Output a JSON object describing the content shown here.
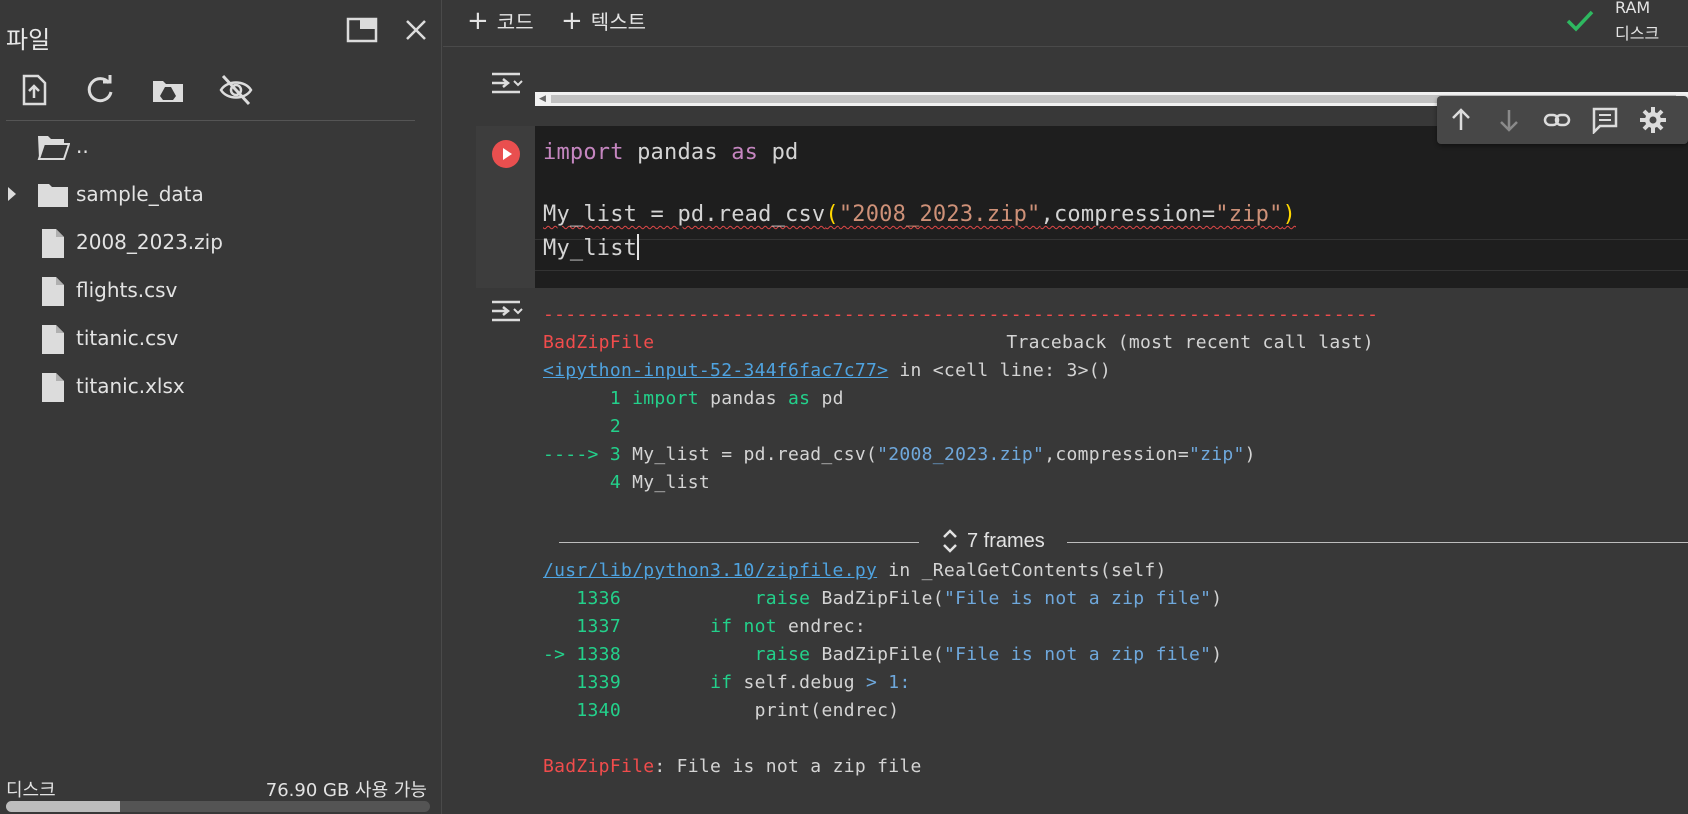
{
  "sidebar": {
    "title": "파일",
    "tree": [
      {
        "label": "..",
        "type": "parent-folder"
      },
      {
        "label": "sample_data",
        "type": "folder"
      },
      {
        "label": "2008_2023.zip",
        "type": "file"
      },
      {
        "label": "flights.csv",
        "type": "file"
      },
      {
        "label": "titanic.csv",
        "type": "file"
      },
      {
        "label": "titanic.xlsx",
        "type": "file"
      }
    ],
    "disk_label": "디스크",
    "disk_free": "76.90 GB 사용 가능",
    "disk_used_fraction": 0.27
  },
  "toolbar": {
    "add_code": "코드",
    "add_text": "텍스트",
    "ram_label": "RAM",
    "disk_label": "디스크"
  },
  "cell": {
    "line1": {
      "kw1": "import",
      "mod": " pandas ",
      "kw2": "as",
      "alias": " pd"
    },
    "line3": {
      "pre": "My_list = pd.read_csv",
      "open": "(",
      "s1": "\"2008_2023.zip\"",
      "mid": ",compression=",
      "s2": "\"zip\"",
      "close": ")"
    },
    "line4": "My_list"
  },
  "output": {
    "dashes": "---------------------------------------------------------------------------",
    "error_name": "BadZipFile",
    "traceback_header": "Traceback (most recent call last)",
    "input_link": "<ipython-input-52-344f6fac7c77>",
    "input_in": " in <cell line: 3>()",
    "src": [
      {
        "prefix": "      1 ",
        "code_kw": "import",
        "code_rest": " pandas ",
        "code_kw2": "as",
        "code_end": " pd"
      },
      {
        "prefix": "      2",
        "code_kw": "",
        "code_rest": "",
        "code_kw2": "",
        "code_end": ""
      },
      {
        "prefix": "----> 3 ",
        "line": "My_list = pd.read_csv(",
        "s1": "\"2008_2023.zip\"",
        "mid": ",compression=",
        "s2": "\"zip\"",
        "end": ")"
      },
      {
        "prefix": "      4 ",
        "line": "My_list"
      }
    ],
    "frames_label": "7 frames",
    "file_link": "/usr/lib/python3.10/zipfile.py",
    "file_in": " in _RealGetContents(self)",
    "lib": [
      {
        "num": "   1336 ",
        "indent": "           ",
        "kw": "raise",
        "rest": " BadZipFile(",
        "str": "\"File is not a zip file\"",
        "end": ")"
      },
      {
        "num": "   1337 ",
        "indent": "       ",
        "kw": "if not",
        "rest": " endrec",
        "str": "",
        "end": ":"
      },
      {
        "num": "-> 1338 ",
        "indent": "           ",
        "kw": "raise",
        "rest": " BadZipFile(",
        "str": "\"File is not a zip file\"",
        "end": ")"
      },
      {
        "num": "   1339 ",
        "indent": "       ",
        "kw": "if",
        "rest": " self.debug ",
        "str": "> 1",
        "end": ":"
      },
      {
        "num": "   1340 ",
        "indent": "           ",
        "kw": "",
        "rest": "print(endrec)",
        "str": "",
        "end": ""
      }
    ],
    "final_error": "BadZipFile",
    "final_msg": ": File is not a zip file"
  },
  "colors": {
    "accent_run": "#e94f4f",
    "check": "#2eb860",
    "error": "#f14c4c"
  }
}
